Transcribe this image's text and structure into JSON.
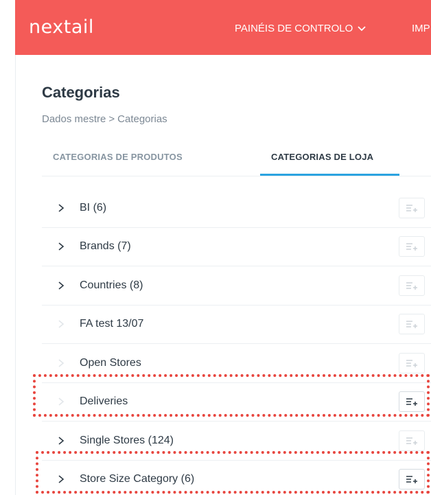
{
  "app": {
    "logo": "nextail",
    "brand_color": "#f45b58",
    "nav": [
      {
        "label": "PAINÉIS DE CONTROLO",
        "icon": "chevron-down-icon"
      },
      {
        "label": "IMP"
      }
    ]
  },
  "page": {
    "title": "Categorias",
    "breadcrumb": [
      "Dados mestre",
      "Categorias"
    ],
    "breadcrumb_separator": ">"
  },
  "tabs": [
    {
      "label": "CATEGORIAS DE PRODUTOS",
      "active": false
    },
    {
      "label": "CATEGORIAS DE LOJA",
      "active": true
    }
  ],
  "categories": [
    {
      "label": "BI (6)",
      "expandable": true,
      "highlighted": false
    },
    {
      "label": "Brands (7)",
      "expandable": true,
      "highlighted": false
    },
    {
      "label": "Countries (8)",
      "expandable": true,
      "highlighted": false
    },
    {
      "label": "FA test 13/07",
      "expandable": false,
      "highlighted": false
    },
    {
      "label": "Open Stores",
      "expandable": false,
      "highlighted": false
    },
    {
      "label": "Deliveries",
      "expandable": false,
      "highlighted": true
    },
    {
      "label": "Single Stores (124)",
      "expandable": true,
      "highlighted": false
    },
    {
      "label": "Store Size Category (6)",
      "expandable": true,
      "highlighted": true
    }
  ],
  "colors": {
    "accent": "#2ba3e0",
    "highlight": "#e8463f"
  }
}
